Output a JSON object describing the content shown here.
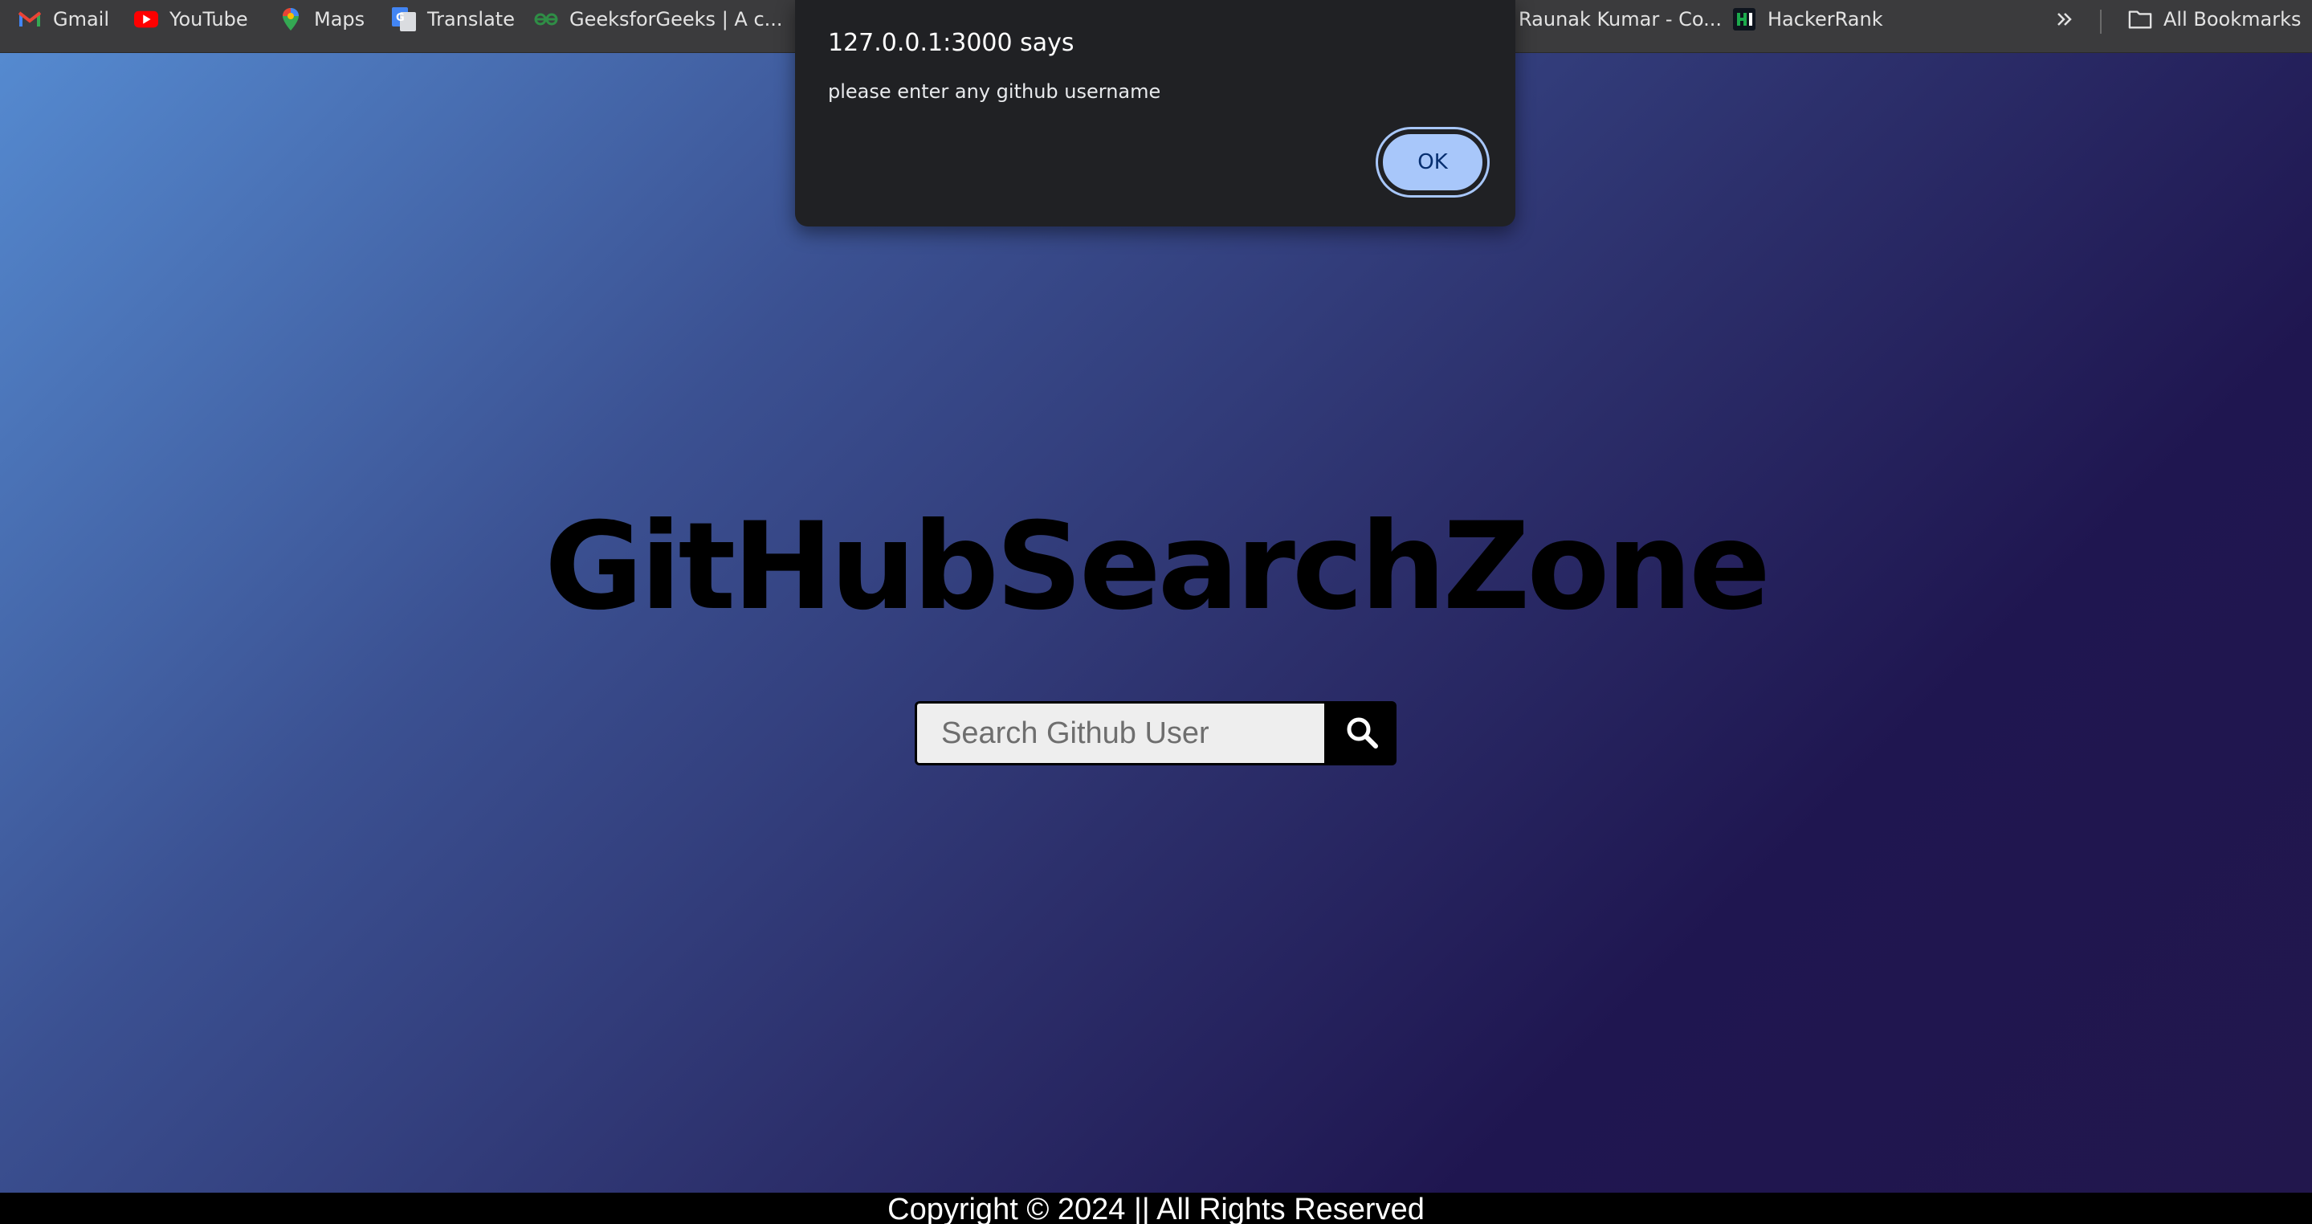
{
  "bookmarks_bar": {
    "items": [
      {
        "label": "Gmail",
        "icon": "gmail-icon"
      },
      {
        "label": "YouTube",
        "icon": "youtube-icon"
      },
      {
        "label": "Maps",
        "icon": "maps-icon"
      },
      {
        "label": "Translate",
        "icon": "translate-icon"
      },
      {
        "label": "GeeksforGeeks | A c...",
        "icon": "geeksforgeeks-icon"
      },
      {
        "label": "Raunak Kumar - Co...",
        "icon": "profile-icon"
      },
      {
        "label": "HackerRank",
        "icon": "hackerrank-icon"
      }
    ],
    "overflow_icon": "chevron-double-right-icon",
    "all_bookmarks_label": "All Bookmarks"
  },
  "page": {
    "title": "GitHubSearchZone",
    "search": {
      "placeholder": "Search Github User",
      "value": "",
      "button_icon": "search-icon"
    },
    "footer": "Copyright © 2024 || All Rights Reserved"
  },
  "dialog": {
    "title": "127.0.0.1:3000 says",
    "message": "please enter any github username",
    "ok_label": "OK"
  },
  "colors": {
    "bookmarks_bg": "#3b3b3d",
    "gradient_start": "#558ad0",
    "gradient_end": "#22174d",
    "dialog_bg": "#202124",
    "ok_button": "#a8c7fa"
  }
}
